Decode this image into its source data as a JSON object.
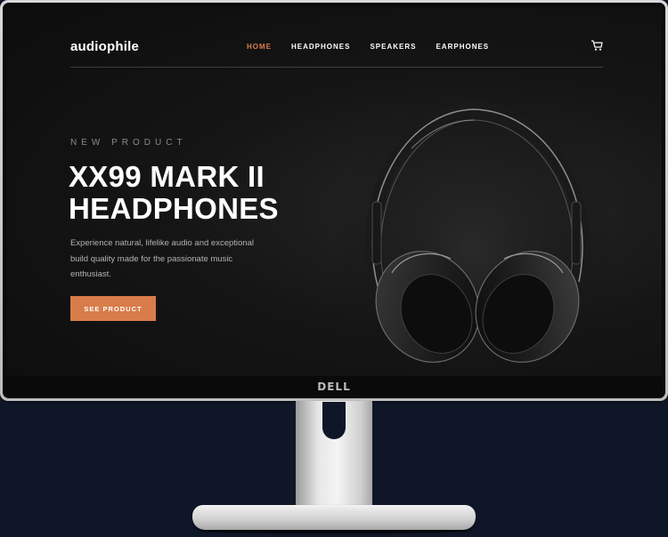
{
  "monitor": {
    "brand": "DELL"
  },
  "header": {
    "logo": "audiophile",
    "nav": [
      {
        "label": "HOME",
        "active": true
      },
      {
        "label": "HEADPHONES",
        "active": false
      },
      {
        "label": "SPEAKERS",
        "active": false
      },
      {
        "label": "EARPHONES",
        "active": false
      }
    ],
    "cart_icon": "cart-icon"
  },
  "hero": {
    "overline": "NEW PRODUCT",
    "title_line1": "XX99 MARK II",
    "title_line2": "HEADPHONES",
    "description": "Experience natural, lifelike audio and exceptional build quality made for the passionate music enthusiast.",
    "cta_label": "SEE PRODUCT",
    "image": "headphones-image"
  },
  "colors": {
    "accent": "#d87d4a",
    "background": "#0f1628",
    "screen": "#141414"
  }
}
